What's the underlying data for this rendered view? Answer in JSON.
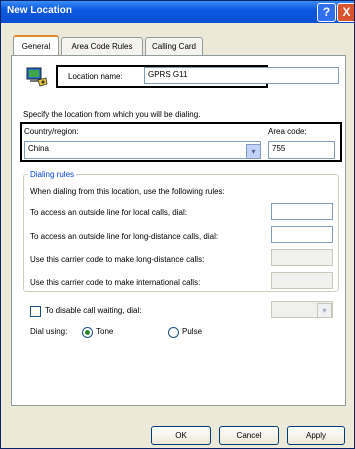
{
  "window": {
    "title": "New Location",
    "help_label": "?",
    "close_label": "X"
  },
  "tabs": [
    {
      "label": "General",
      "active": true
    },
    {
      "label": "Area Code Rules",
      "active": false
    },
    {
      "label": "Calling Card",
      "active": false
    }
  ],
  "location": {
    "label": "Location name:",
    "value": "GPRS G11"
  },
  "specify_text": "Specify the location from which you will be dialing.",
  "country": {
    "label": "Country/region:",
    "value": "China"
  },
  "area_code": {
    "label": "Area code:",
    "value": "755"
  },
  "dialing_rules": {
    "title": "Dialing rules",
    "intro": "When dialing from this location, use the following rules:",
    "local_label": "To access an outside line for local calls, dial:",
    "long_distance_label": "To access an outside line for long-distance calls, dial:",
    "carrier_long_label": "Use this carrier code to make long-distance calls:",
    "carrier_intl_label": "Use this carrier code to make international calls:"
  },
  "call_waiting": {
    "label": "To disable call waiting, dial:",
    "checked": false
  },
  "dial_using": {
    "label": "Dial using:",
    "tone_label": "Tone",
    "pulse_label": "Pulse",
    "selected": "Tone"
  },
  "buttons": {
    "ok": "OK",
    "cancel": "Cancel",
    "apply": "Apply"
  },
  "icons": {
    "location": "computer-phone-icon",
    "dropdown": "chevron-down-icon"
  }
}
